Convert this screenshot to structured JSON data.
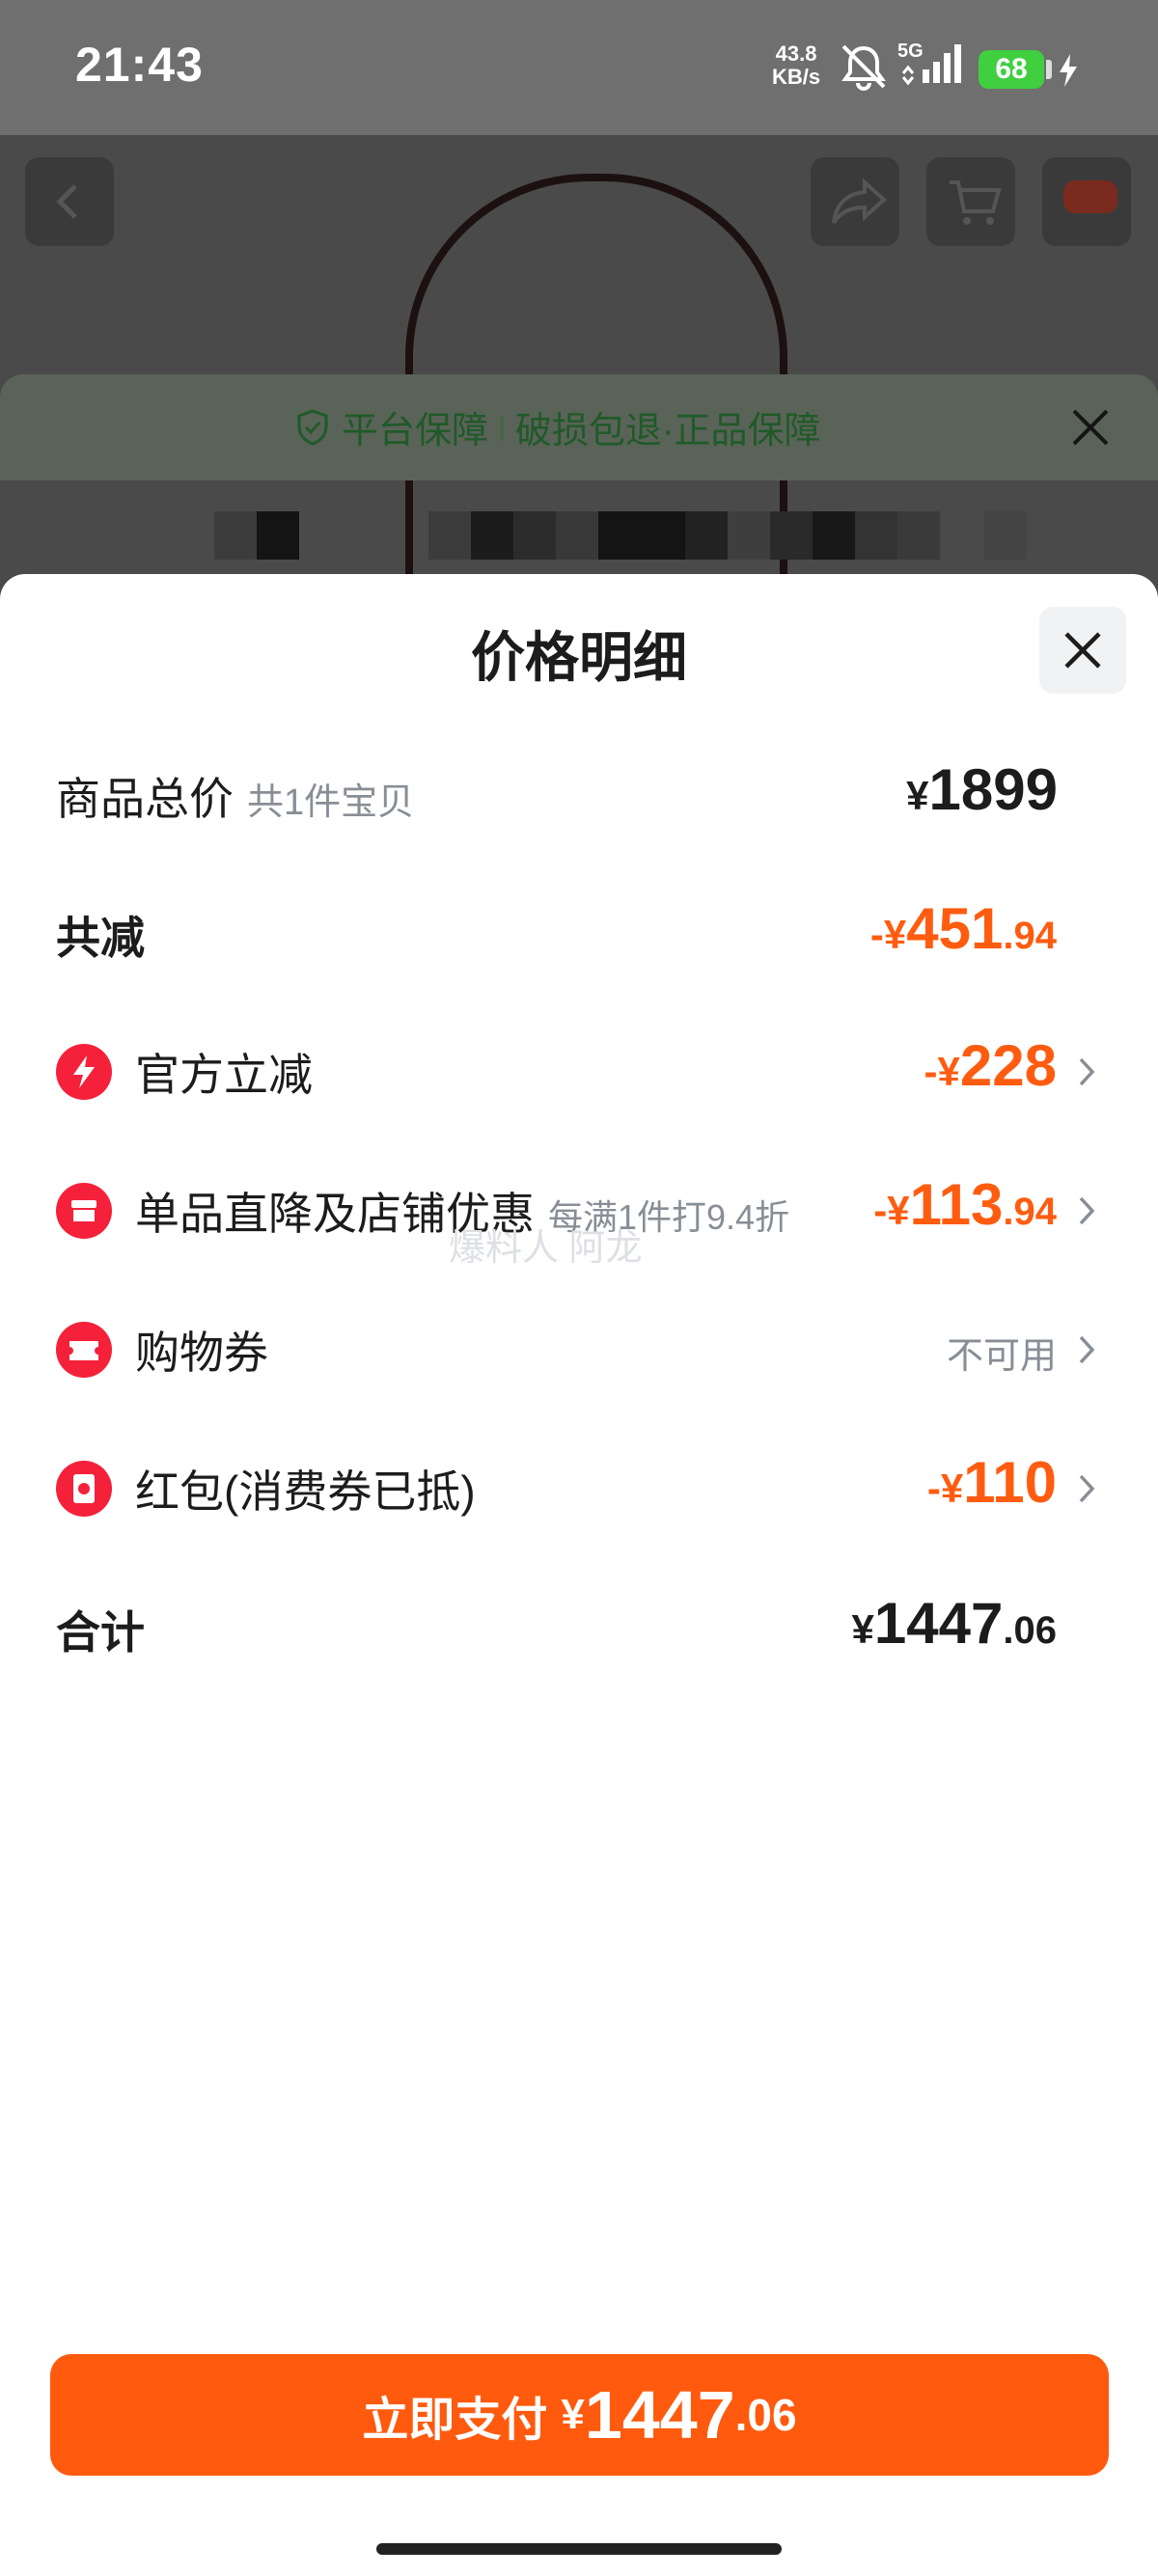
{
  "status_bar": {
    "time": "21:43",
    "net_speed_value": "43.8",
    "net_speed_unit": "KB/s",
    "signal": "5G",
    "battery": "68"
  },
  "background": {
    "guarantee_title": "平台保障",
    "guarantee_sep": "|",
    "guarantee_detail": "破损包退·正品保障"
  },
  "sheet": {
    "title": "价格明细",
    "rows": {
      "total": {
        "label": "商品总价",
        "sub": "共1件宝贝",
        "cur": "¥",
        "amount": "1899"
      },
      "reduction": {
        "label": "共减",
        "cur": "-¥",
        "amount": "451",
        "decimal": ".94"
      },
      "official": {
        "label": "官方立减",
        "cur": "-¥",
        "amount": "228"
      },
      "store": {
        "label": "单品直降及店铺优惠",
        "sub": "每满1件打9.4折",
        "cur": "-¥",
        "amount": "113",
        "decimal": ".94"
      },
      "coupon": {
        "label": "购物券",
        "status": "不可用"
      },
      "redpacket": {
        "label": "红包(消费券已抵)",
        "cur": "-¥",
        "amount": "110"
      },
      "sum": {
        "label": "合计",
        "cur": "¥",
        "amount": "1447",
        "decimal": ".06"
      }
    },
    "watermark": "爆料人 阿龙"
  },
  "pay_button": {
    "label": "立即支付",
    "cur": "¥",
    "amount": "1447",
    "decimal": ".06"
  },
  "colors": {
    "accent": "#ff5a0e",
    "discount": "#ff5c10",
    "icon_red": "#f5213a",
    "guarantee_green": "#1f5a28"
  }
}
